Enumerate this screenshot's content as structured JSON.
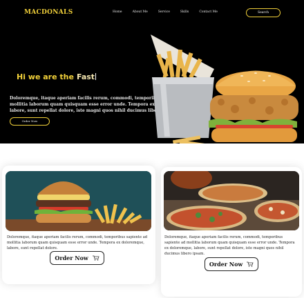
{
  "brand": {
    "logo": "MACDONALS"
  },
  "nav": {
    "items": [
      "Home",
      "About Me",
      "Service",
      "Skills",
      "Contact Me"
    ]
  },
  "header": {
    "search_label": "Search"
  },
  "hero": {
    "headline_prefix": "Hi we are the",
    "headline_word": "Fast",
    "description": "Doloremque, itaque aperiam facilis rerum, commodi, temporibus sapiente ad mollitia laborum quam quisquam esse error unde. Tempora ex doloremque, labore, sunt repellat dolore, iste magni quos nihil ducimus libero ipsam.",
    "order_label": "Order Now"
  },
  "cards": [
    {
      "image": "burger-and-fries-photo",
      "text": "Doloremque, itaque aperiam facilis rerum, commodi, temporibus sapiente ad mollitia laborum quam quisquam esse error unde. Tempora ex doloremque, labore, sunt repellat dolore.",
      "order_label": "Order Now"
    },
    {
      "image": "pizzas-photo",
      "text": "Doloremque, itaque aperiam facilis rerum, commodi, temporibus sapiente ad mollitia laborum quam quisquam esse error unde. Tempora ex doloremque, labore, sunt repellat dolore, iste magni quos nihil ducimus libero ipsam.",
      "order_label": "Order Now"
    }
  ],
  "colors": {
    "accent": "#f2d13a",
    "hero_bg": "#000000",
    "card_bg": "#ffffff"
  },
  "icons": [
    "cart-icon"
  ]
}
